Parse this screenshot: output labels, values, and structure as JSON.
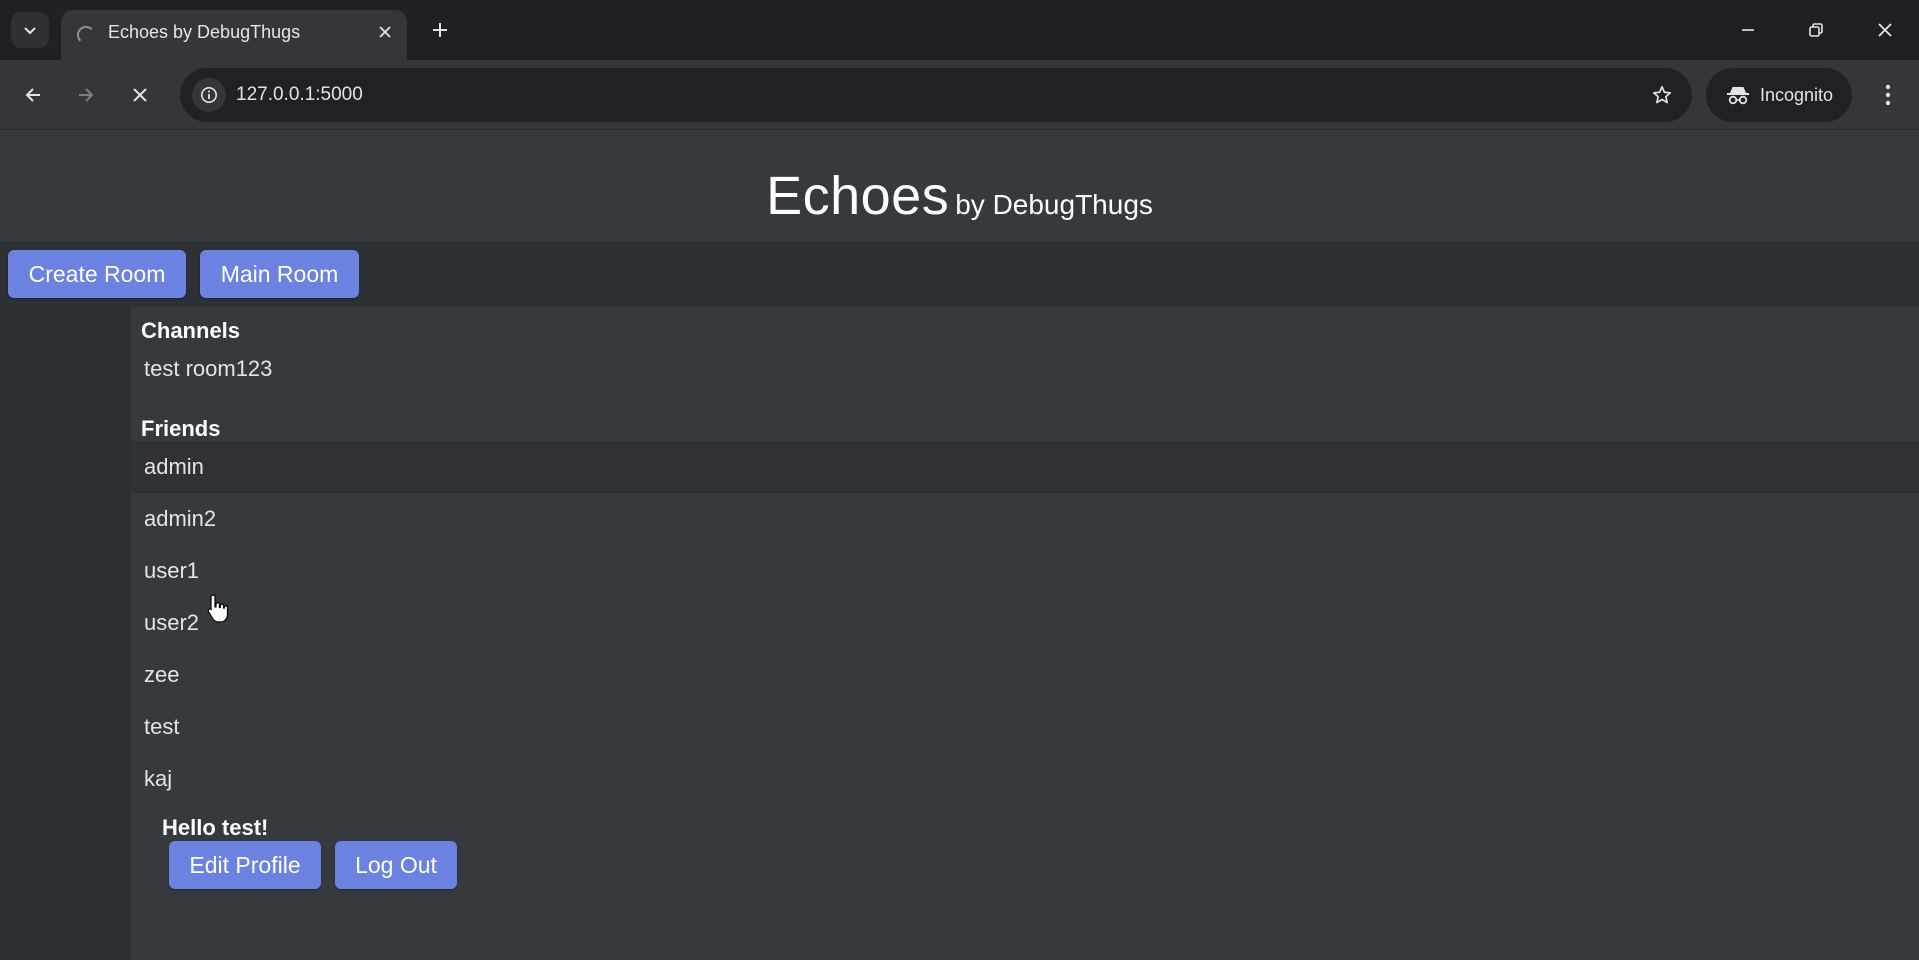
{
  "browser": {
    "tab": {
      "title": "Echoes by DebugThugs"
    },
    "address_bar": {
      "url": "127.0.0.1:5000"
    },
    "incognito_label": "Incognito"
  },
  "header": {
    "brand": "Echoes",
    "byline": "by DebugThugs"
  },
  "nav": {
    "create_room": "Create Room",
    "main_room": "Main Room"
  },
  "sidebar": {
    "channels_title": "Channels",
    "channels": [
      {
        "label": "test room123"
      }
    ],
    "friends_title": "Friends",
    "friends": [
      {
        "label": "admin"
      },
      {
        "label": "admin2"
      },
      {
        "label": "user1"
      },
      {
        "label": "user2"
      },
      {
        "label": "zee"
      },
      {
        "label": "test"
      },
      {
        "label": "kaj"
      }
    ]
  },
  "user_panel": {
    "greeting": "Hello test!",
    "edit_profile": "Edit Profile",
    "log_out": "Log Out"
  },
  "colors": {
    "button": "#6b82e0",
    "page_bg": "#363a3f",
    "navbar_bg": "#2d3136",
    "hover_row": "#2f3134"
  }
}
